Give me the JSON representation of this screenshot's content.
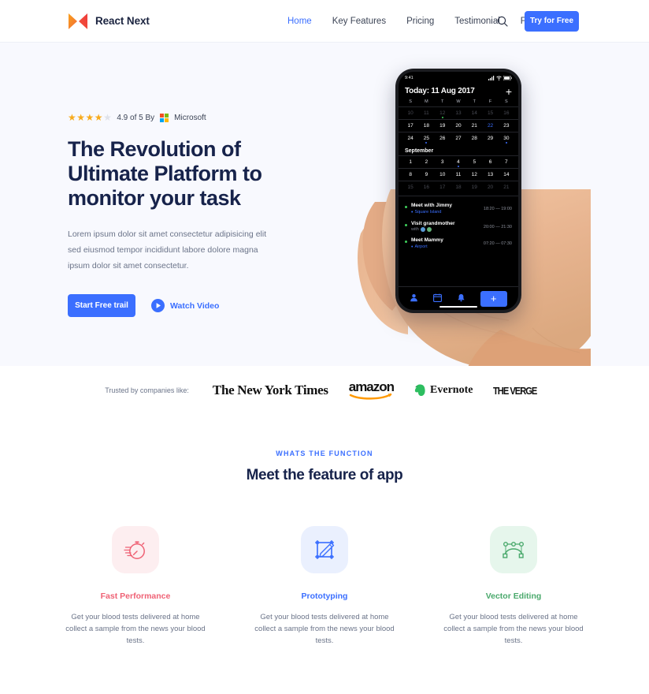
{
  "brand": {
    "name": "React Next",
    "logo_icon": "react-next-bowtie-logo",
    "colors": [
      "#f9a01b",
      "#f26b3a",
      "#ef3b3b"
    ]
  },
  "header": {
    "nav": [
      {
        "label": "Home",
        "active": true
      },
      {
        "label": "Key Features",
        "active": false
      },
      {
        "label": "Pricing",
        "active": false
      },
      {
        "label": "Testimonial",
        "active": false
      },
      {
        "label": "Faq",
        "active": false
      }
    ],
    "search_icon": "search-icon",
    "cta_label": "Try for Free",
    "accent": "#3b6fff"
  },
  "hero": {
    "rating": {
      "stars_filled": 4,
      "stars_total": 5,
      "text": "4.9 of 5 By",
      "brand": "Microsoft",
      "star_color": "#f8ab1c"
    },
    "title": "The Revolution of Ultimate Platform to monitor your task",
    "subtitle": "Lorem ipsum dolor sit amet consectetur adipisicing elit sed eiusmod tempor incididunt labore dolore magna ipsum dolor sit amet consectetur.",
    "primary_cta": "Start Free trail",
    "video_cta": "Watch Video",
    "background": "#f8f9fe"
  },
  "phone": {
    "status": {
      "time": "9:41",
      "signal_icon": "signal-bars-icon",
      "wifi_icon": "wifi-icon",
      "battery_icon": "battery-icon"
    },
    "calendar_title": "Today: 11 Aug 2017",
    "add_icon": "plus-icon",
    "day_headers": [
      "S",
      "M",
      "T",
      "W",
      "T",
      "F",
      "S"
    ],
    "weeks": [
      {
        "days": [
          {
            "n": "10",
            "style": "dim"
          },
          {
            "n": "11",
            "style": "dim"
          },
          {
            "n": "12",
            "style": "dim",
            "dot": "green"
          },
          {
            "n": "13",
            "style": "dim"
          },
          {
            "n": "14",
            "style": "dim"
          },
          {
            "n": "15",
            "style": "dim"
          },
          {
            "n": "16",
            "style": "dim"
          }
        ]
      },
      {
        "days": [
          {
            "n": "17"
          },
          {
            "n": "18"
          },
          {
            "n": "19"
          },
          {
            "n": "20"
          },
          {
            "n": "21",
            "style": "sel"
          },
          {
            "n": "22",
            "style": "blue"
          },
          {
            "n": "23"
          }
        ]
      },
      {
        "days": [
          {
            "n": "24"
          },
          {
            "n": "25",
            "dot": "blue"
          },
          {
            "n": "26"
          },
          {
            "n": "27"
          },
          {
            "n": "28"
          },
          {
            "n": "29"
          },
          {
            "n": "30",
            "dot": "blue"
          }
        ]
      }
    ],
    "month_label": "September",
    "weeks2": [
      {
        "days": [
          {
            "n": "1"
          },
          {
            "n": "2"
          },
          {
            "n": "3"
          },
          {
            "n": "4",
            "dot": "blue"
          },
          {
            "n": "5"
          },
          {
            "n": "6"
          },
          {
            "n": "7"
          }
        ]
      },
      {
        "days": [
          {
            "n": "8"
          },
          {
            "n": "9"
          },
          {
            "n": "10"
          },
          {
            "n": "11"
          },
          {
            "n": "12"
          },
          {
            "n": "13"
          },
          {
            "n": "14"
          }
        ]
      },
      {
        "days": [
          {
            "n": "15",
            "style": "dim"
          },
          {
            "n": "16",
            "style": "dim"
          },
          {
            "n": "17",
            "style": "dim"
          },
          {
            "n": "18",
            "style": "dim"
          },
          {
            "n": "19",
            "style": "dim"
          },
          {
            "n": "20",
            "style": "dim"
          },
          {
            "n": "21",
            "style": "dim"
          }
        ]
      }
    ],
    "events": [
      {
        "name": "Meet with Jimmy",
        "meta": "Square Island",
        "meta_type": "location",
        "time": "18:20 — 19:00"
      },
      {
        "name": "Visit grandmother",
        "meta": "with",
        "meta_type": "people",
        "time": "20:00 — 21:30"
      },
      {
        "name": "Meet Mammy",
        "meta": "Airport",
        "meta_type": "location",
        "time": "07:20 — 07:30"
      }
    ],
    "tabs": [
      "person-icon",
      "calendar-icon",
      "bell-icon",
      "plus-icon"
    ]
  },
  "logos": {
    "label": "Trusted by companies like:",
    "items": [
      {
        "name": "The New York Times",
        "icon": "nyt-logo"
      },
      {
        "name": "amazon",
        "icon": "amazon-logo"
      },
      {
        "name": "Evernote",
        "icon": "evernote-logo"
      },
      {
        "name": "THE VERGE",
        "icon": "the-verge-logo"
      }
    ]
  },
  "features": {
    "eyebrow": "WHATS THE FUNCTION",
    "title": "Meet the feature of app",
    "cards": [
      {
        "title": "Fast Performance",
        "text": "Get your blood tests delivered at home collect a sample from the news your blood tests.",
        "icon": "stopwatch-icon",
        "color": "#ef6275",
        "bg": "#fdeef0"
      },
      {
        "title": "Prototyping",
        "text": "Get your blood tests delivered at home collect a sample from the news your blood tests.",
        "icon": "artboard-pencil-icon",
        "color": "#3b6fff",
        "bg": "#eaf0fe"
      },
      {
        "title": "Vector Editing",
        "text": "Get your blood tests delivered at home collect a sample from the news your blood tests.",
        "icon": "bezier-pen-path-icon",
        "color": "#4aa96c",
        "bg": "#e6f6ec"
      }
    ]
  }
}
